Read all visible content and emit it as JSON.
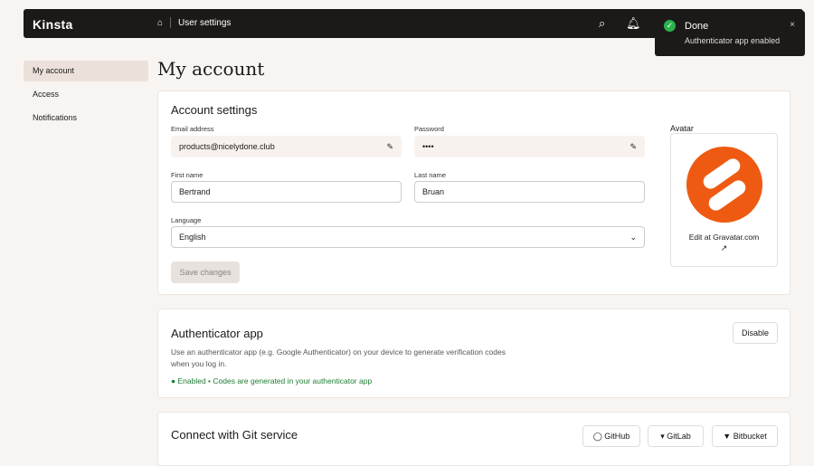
{
  "header": {
    "logo": "Kinsta",
    "breadcrumb": "User settings"
  },
  "toast": {
    "title": "Done",
    "message": "Authenticator app enabled",
    "close": "×"
  },
  "sidebar": {
    "items": [
      {
        "label": "My account"
      },
      {
        "label": "Access"
      },
      {
        "label": "Notifications"
      }
    ]
  },
  "page_title": "My account",
  "account": {
    "title": "Account settings",
    "email_label": "Email address",
    "email": "products@nicelydone.club",
    "password_label": "Password",
    "password": "••••",
    "first_label": "First name",
    "first": "Bertrand",
    "last_label": "Last name",
    "last": "Bruan",
    "language_label": "Language",
    "language": "English",
    "save": "Save changes",
    "avatar_label": "Avatar",
    "gravatar": "Edit at Gravatar.com"
  },
  "auth": {
    "title": "Authenticator app",
    "desc": "Use an authenticator app (e.g. Google Authenticator) on your device to generate verification codes when you log in.",
    "status": "Enabled • Codes are generated in your authenticator app",
    "disable": "Disable"
  },
  "git": {
    "title": "Connect with Git service",
    "github": "GitHub",
    "gitlab": "GitLab",
    "bitbucket": "Bitbucket"
  }
}
